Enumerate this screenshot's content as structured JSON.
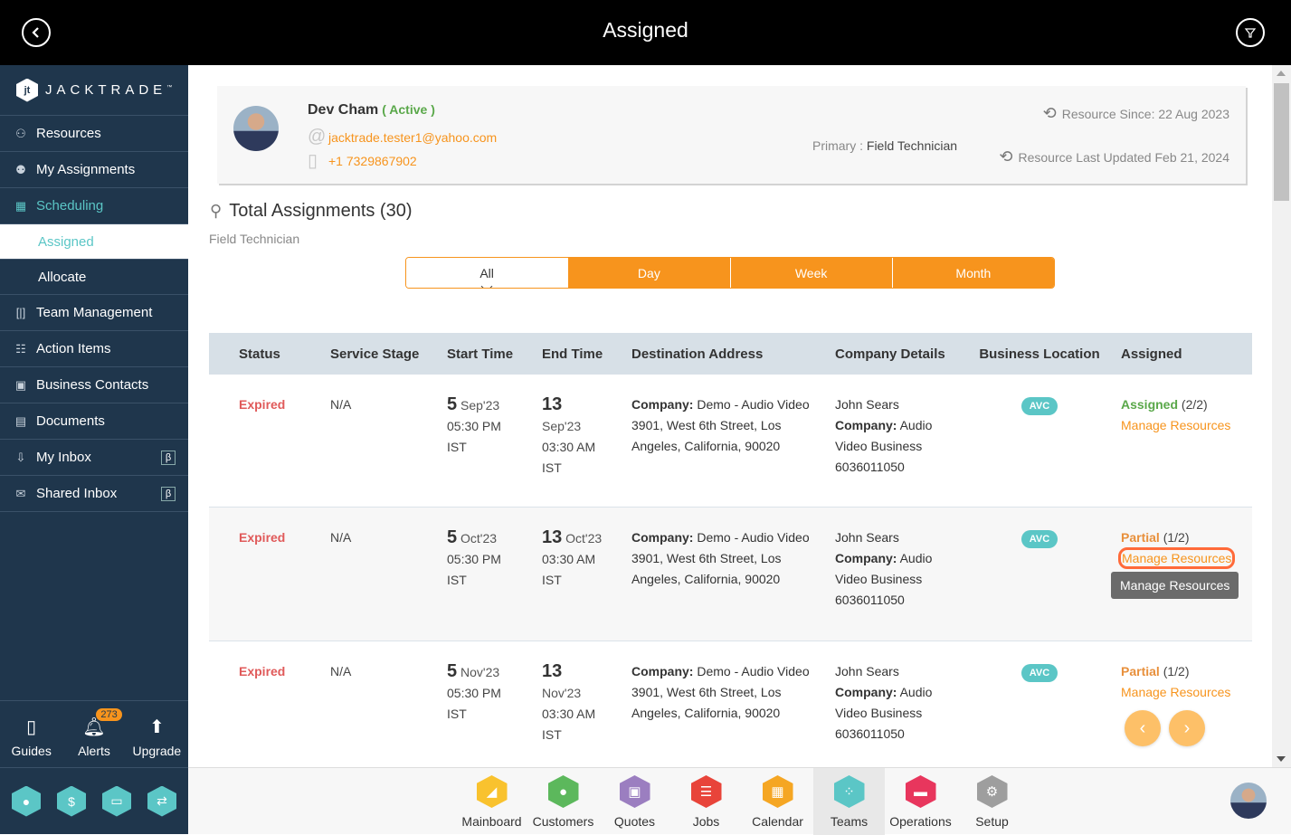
{
  "header": {
    "title": "Assigned",
    "back_icon": "chevron-left-circle-icon",
    "filter_icon": "filter-icon"
  },
  "sidebar": {
    "brand": "JACKTRADE",
    "brand_tm": "™",
    "items": [
      {
        "label": "Resources",
        "icon": "resources-icon"
      },
      {
        "label": "My Assignments",
        "icon": "assignments-icon"
      },
      {
        "label": "Scheduling",
        "icon": "scheduling-icon",
        "active": true
      },
      {
        "label": "Assigned",
        "sub": true,
        "selected": true
      },
      {
        "label": "Allocate",
        "sub": true
      },
      {
        "label": "Team Management",
        "icon": "team-management-icon"
      },
      {
        "label": "Action Items",
        "icon": "clipboard-icon"
      },
      {
        "label": "Business Contacts",
        "icon": "contacts-icon"
      },
      {
        "label": "Documents",
        "icon": "document-icon"
      },
      {
        "label": "My Inbox",
        "icon": "inbox-icon",
        "beta": "β"
      },
      {
        "label": "Shared Inbox",
        "icon": "mail-icon",
        "beta": "β"
      }
    ],
    "bottom": [
      {
        "label": "Guides",
        "icon": "book-icon"
      },
      {
        "label": "Alerts",
        "icon": "bell-icon",
        "badge": "273"
      },
      {
        "label": "Upgrade",
        "icon": "arrow-up-icon"
      }
    ],
    "hex_shortcuts": [
      "user-icon",
      "dollar-icon",
      "money-icon",
      "workflow-icon"
    ]
  },
  "profile": {
    "name": "Dev Cham",
    "status": "( Active )",
    "email": "jacktrade.tester1@yahoo.com",
    "phone": "+1 7329867902",
    "primary_label": "Primary : ",
    "primary_value": "Field Technician",
    "since": "Resource Since: 22 Aug 2023",
    "updated": "Resource Last Updated Feb 21, 2024"
  },
  "summary": {
    "title": "Total Assignments (30)",
    "subtitle": "Field Technician"
  },
  "tabs": [
    {
      "label": "All",
      "active": true
    },
    {
      "label": "Day"
    },
    {
      "label": "Week"
    },
    {
      "label": "Month"
    }
  ],
  "table": {
    "columns": [
      "Status",
      "Service Stage",
      "Start Time",
      "End Time",
      "Destination Address",
      "Company Details",
      "Business Location",
      "Assigned"
    ],
    "rows": [
      {
        "status": "Expired",
        "stage": "N/A",
        "start_day": "5",
        "start_mon": "Sep'23",
        "start_time": "05:30 PM",
        "start_tz": "IST",
        "end_day": "13",
        "end_mon": "Sep'23",
        "end_time": "03:30 AM",
        "end_tz": "IST",
        "dest_label": "Company:",
        "dest_company": " Demo - Audio Video",
        "dest_line1": "3901, West 6th Street, Los",
        "dest_line2": "Angeles, California, 90020",
        "contact": "John Sears",
        "comp_label": "Company:",
        "comp_name1": " Audio",
        "comp_name2": "Video Business",
        "comp_phone": "6036011050",
        "location": "AVC",
        "assign_state": "Assigned",
        "assign_count": " (2/2)",
        "manage": "Manage Resources"
      },
      {
        "status": "Expired",
        "stage": "N/A",
        "start_day": "5",
        "start_mon": "Oct'23",
        "start_time": "05:30 PM",
        "start_tz": "IST",
        "end_day": "13",
        "end_mon": "Oct'23",
        "end_time": "03:30 AM",
        "end_tz": "IST",
        "dest_label": "Company:",
        "dest_company": " Demo - Audio Video",
        "dest_line1": "3901, West 6th Street, Los",
        "dest_line2": "Angeles, California, 90020",
        "contact": "John Sears",
        "comp_label": "Company:",
        "comp_name1": " Audio",
        "comp_name2": "Video Business",
        "comp_phone": "6036011050",
        "location": "AVC",
        "assign_state": "Partial",
        "assign_count": " (1/2)",
        "manage": "Manage Resources",
        "tooltip": "Manage Resources"
      },
      {
        "status": "Expired",
        "stage": "N/A",
        "start_day": "5",
        "start_mon": "Nov'23",
        "start_time": "05:30 PM",
        "start_tz": "IST",
        "end_day": "13",
        "end_mon": "Nov'23",
        "end_time": "03:30 AM",
        "end_tz": "IST",
        "dest_label": "Company:",
        "dest_company": " Demo - Audio Video",
        "dest_line1": "3901, West 6th Street, Los",
        "dest_line2": "Angeles, California, 90020",
        "contact": "John Sears",
        "comp_label": "Company:",
        "comp_name1": " Audio",
        "comp_name2": "Video Business",
        "comp_phone": "6036011050",
        "location": "AVC",
        "assign_state": "Partial",
        "assign_count": " (1/2)",
        "manage": "Manage Resources"
      }
    ]
  },
  "pager": {
    "prev": "‹",
    "next": "›"
  },
  "dock": [
    {
      "label": "Mainboard",
      "icon": "mainboard-icon",
      "color": "#f9c22e"
    },
    {
      "label": "Customers",
      "icon": "customers-icon",
      "color": "#5cb85c"
    },
    {
      "label": "Quotes",
      "icon": "quotes-icon",
      "color": "#9b7ec0"
    },
    {
      "label": "Jobs",
      "icon": "jobs-icon",
      "color": "#e8443a"
    },
    {
      "label": "Calendar",
      "icon": "calendar-icon",
      "color": "#f5a623"
    },
    {
      "label": "Teams",
      "icon": "teams-icon",
      "color": "#5bc6c6",
      "active": true
    },
    {
      "label": "Operations",
      "icon": "operations-icon",
      "color": "#e8365d"
    },
    {
      "label": "Setup",
      "icon": "gear-icon",
      "color": "#9e9e9e"
    }
  ],
  "colors": {
    "accent": "#f7941d",
    "teal": "#5bc6c6",
    "sidebar_bg": "#1f364c",
    "expired": "#e05a5a",
    "assigned": "#5aa84a",
    "partial": "#e8903c"
  }
}
